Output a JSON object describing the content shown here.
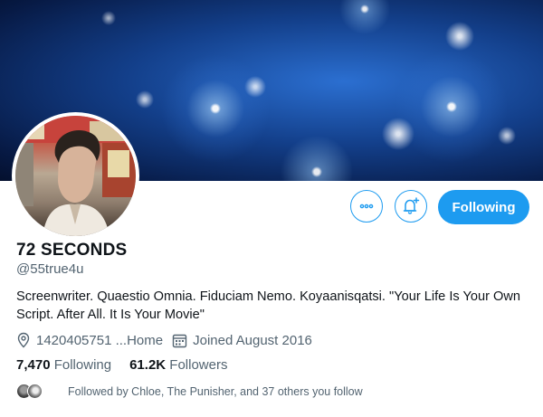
{
  "profile": {
    "name": "72 SECONDS",
    "handle": "@55true4u",
    "bio": "Screenwriter. Quaestio Omnia. Fiduciam Nemo. Koyaanisqatsi. \"Your Life Is Your Own Script. After All. It Is Your Movie\"",
    "location": "1420405751 ...Home",
    "joined": "Joined August 2016"
  },
  "actions": {
    "more_icon": "more-options-icon",
    "notify_icon": "bell-plus-icon",
    "follow_label": "Following"
  },
  "stats": {
    "following_count": "7,470",
    "following_label": "Following",
    "followers_count": "61.2K",
    "followers_label": "Followers"
  },
  "followed_by": "Followed by Chloe, The Punisher, and 37 others you follow",
  "colors": {
    "accent": "#1d9bf0",
    "secondary_text": "#536471",
    "primary_text": "#0f1419"
  }
}
